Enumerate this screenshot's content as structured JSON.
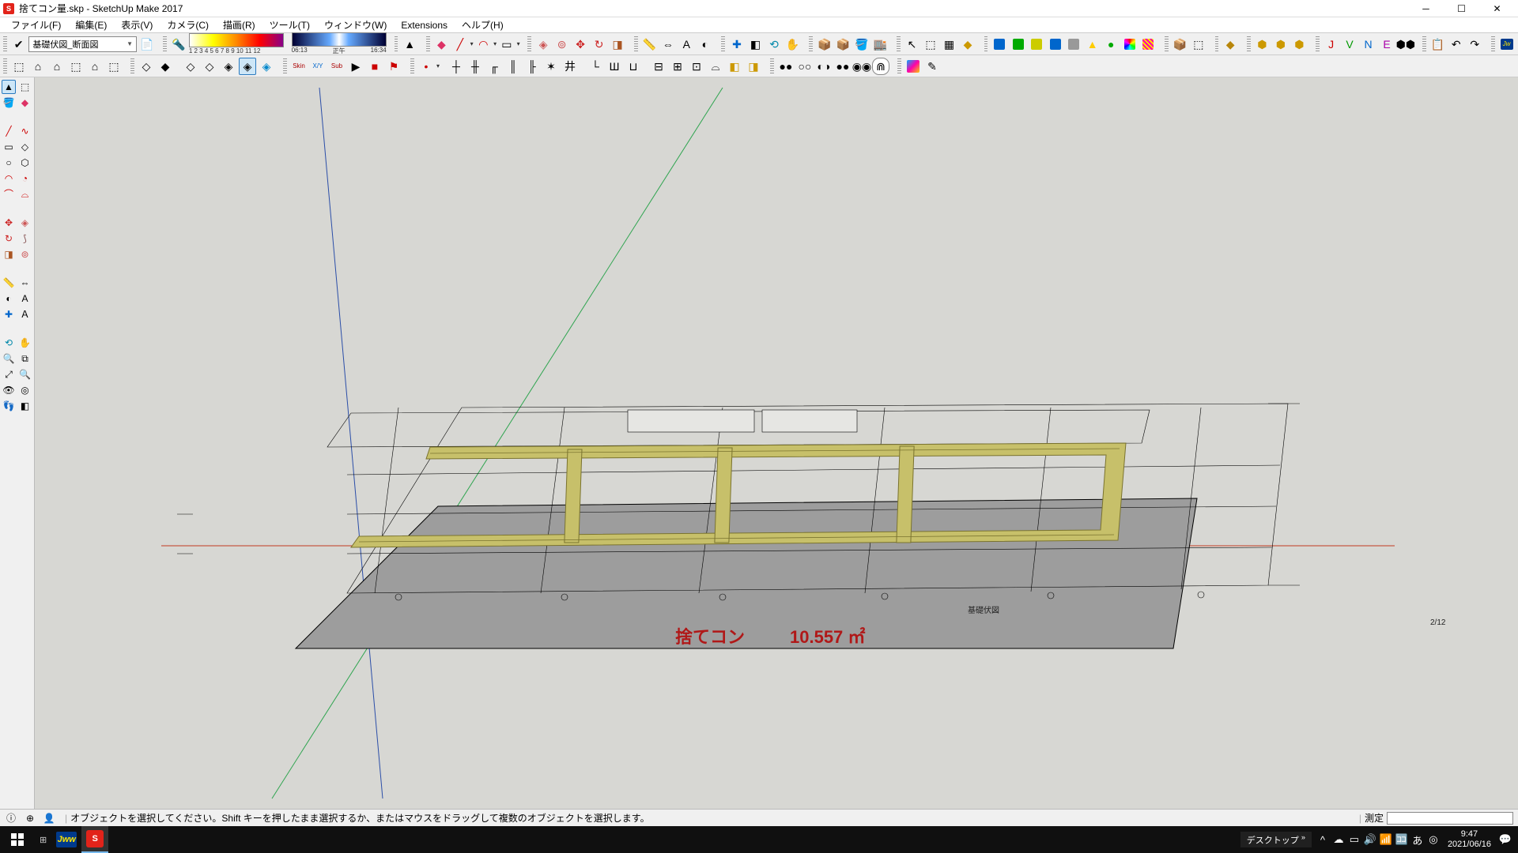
{
  "titlebar": {
    "title": "捨てコン量.skp - SketchUp Make 2017"
  },
  "menu": {
    "file": "ファイル(F)",
    "edit": "編集(E)",
    "view": "表示(V)",
    "camera": "カメラ(C)",
    "draw": "描画(R)",
    "tools": "ツール(T)",
    "window": "ウィンドウ(W)",
    "extensions": "Extensions",
    "help": "ヘルプ(H)"
  },
  "layer": {
    "current": "基礎伏図_断面図"
  },
  "shadow": {
    "tick_labels": "1 2 3 4 5 6 7 8 9 10 11 12",
    "time_start": "06:13",
    "time_mid": "正午",
    "time_end": "16:34"
  },
  "viewport": {
    "overlay_label": "捨てコン",
    "overlay_value": "10.557 ㎡",
    "plan_title": "基礎伏図",
    "page_note": "2/12"
  },
  "status": {
    "hint": "オブジェクトを選択してください。Shift キーを押したまま選択するか、またはマウスをドラッグして複数のオブジェクトを選択します。",
    "measure_label": "測定"
  },
  "taskbar": {
    "desktop_label": "デスクトップ",
    "ime": "あ",
    "time": "9:47",
    "date": "2021/06/16"
  },
  "colors": {
    "axis_r": "#c23b22",
    "axis_g": "#2ea44f",
    "axis_b": "#2b4ea8",
    "plan_fill": "#9d9d9d",
    "foundation": "#c7c06a"
  }
}
